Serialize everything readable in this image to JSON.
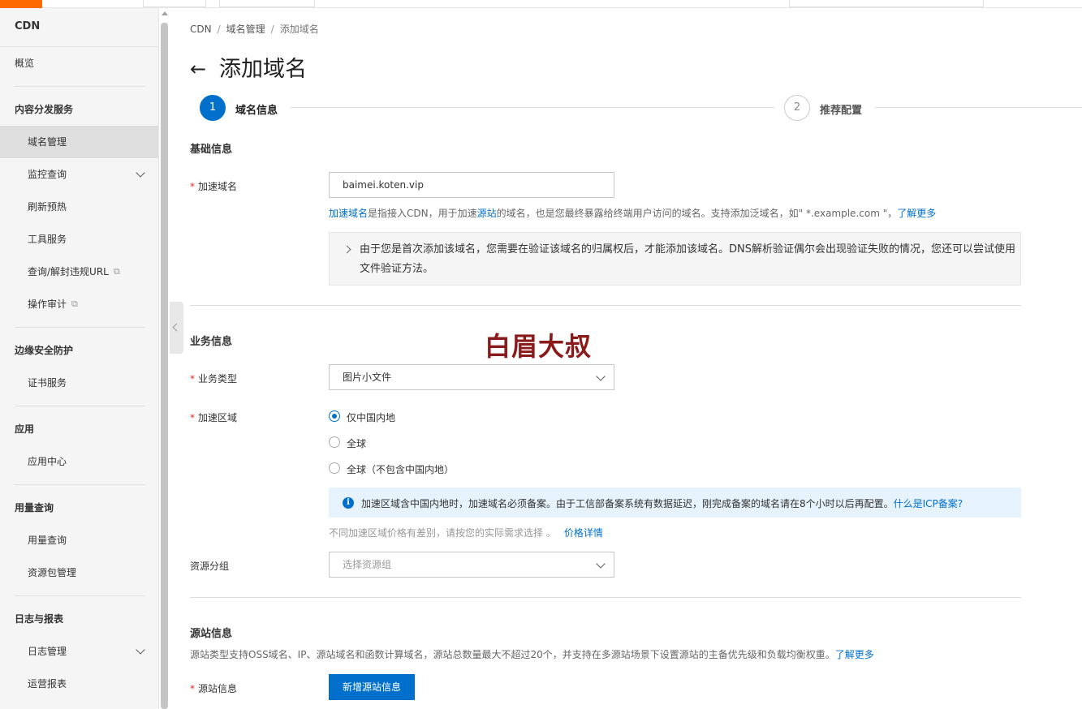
{
  "sidebar": {
    "title": "CDN",
    "overview": "概览",
    "groups": [
      {
        "label": "内容分发服务",
        "items": [
          "域名管理",
          "监控查询",
          "刷新预热",
          "工具服务",
          "查询/解封违规URL",
          "操作审计"
        ]
      },
      {
        "label": "边缘安全防护",
        "items": [
          "证书服务"
        ]
      },
      {
        "label": "应用",
        "items": [
          "应用中心"
        ]
      },
      {
        "label": "用量查询",
        "items": [
          "用量查询",
          "资源包管理"
        ]
      },
      {
        "label": "日志与报表",
        "items": [
          "日志管理",
          "运营报表"
        ]
      }
    ],
    "active_item": "域名管理",
    "external_icon": "external-link-icon"
  },
  "breadcrumb": [
    "CDN",
    "域名管理",
    "添加域名"
  ],
  "page_title": "添加域名",
  "steps": [
    {
      "number": "1",
      "label": "域名信息",
      "state": "active"
    },
    {
      "number": "2",
      "label": "推荐配置",
      "state": "pending"
    }
  ],
  "basic": {
    "section_title": "基础信息",
    "domain_label": "加速域名",
    "domain_value": "baimei.koten.vip",
    "help_link1": "加速域名",
    "help_text1": "是指接入CDN，用于加速",
    "help_link2": "源站",
    "help_text2": "的域名，也是您最终暴露给终端用户访问的域名。支持添加泛域名，如\" *.example.com \"，",
    "help_link3": "了解更多",
    "notice_text": "由于您是首次添加该域名，您需要在验证该域名的归属权后，才能添加该域名。DNS解析验证偶尔会出现验证失败的情况，您还可以尝试使用文件验证方法。"
  },
  "business": {
    "section_title": "业务信息",
    "watermark": "白眉大叔",
    "type_label": "业务类型",
    "type_value": "图片小文件",
    "region_label": "加速区域",
    "region_options": [
      "仅中国内地",
      "全球",
      "全球（不包含中国内地）"
    ],
    "region_selected": "仅中国内地",
    "info_text": "加速区域含中国内地时，加速域名必须备案。由于工信部备案系统有数据延迟，刚完成备案的域名请在8个小时以后再配置。",
    "info_link": "什么是ICP备案?",
    "price_note": "不同加速区域价格有差别，请按您的实际需求选择 。",
    "price_link": "价格详情",
    "resource_label": "资源分组",
    "resource_placeholder": "选择资源组"
  },
  "origin": {
    "section_title": "源站信息",
    "desc": "源站类型支持OSS域名、IP、源站域名和函数计算域名，源站总数量最大不超过20个，并支持在多源站场景下设置源站的主备优先级和负载均衡权重。",
    "desc_link": "了解更多",
    "label": "源站信息",
    "add_button": "新增源站信息"
  },
  "colors": {
    "accent": "#0070cc",
    "brand": "#ff6a00",
    "required": "#d93026"
  }
}
